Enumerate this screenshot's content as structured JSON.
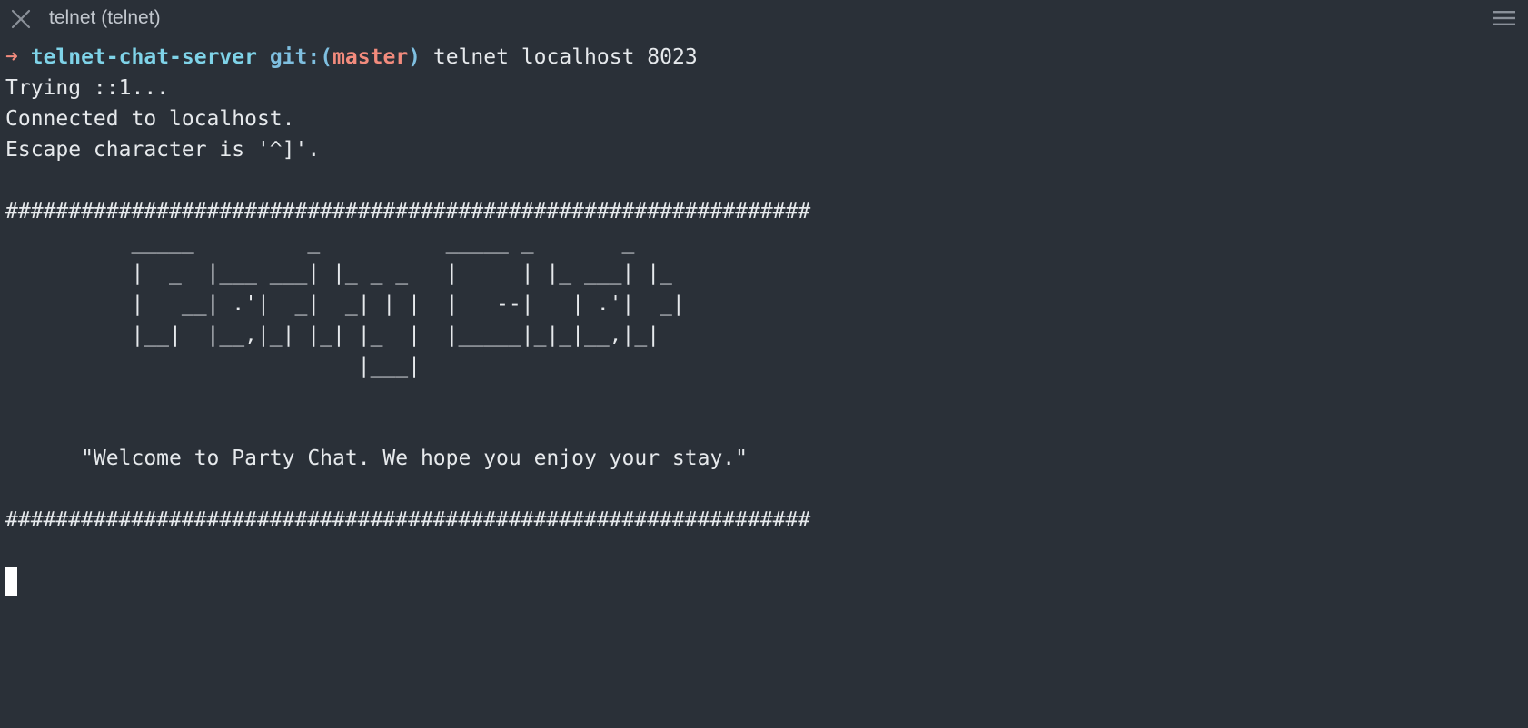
{
  "window": {
    "title": "telnet (telnet)",
    "close_icon": "close-icon",
    "menu_icon": "hamburger-menu-icon"
  },
  "colors": {
    "background": "#2a3038",
    "text": "#e6e9ec",
    "prompt_arrow": "#f28b7d",
    "directory": "#7fd3e8",
    "git_label": "#7fbfe0",
    "branch": "#f28b7d"
  },
  "prompt": {
    "arrow": "➜",
    "directory": "telnet-chat-server",
    "git_open": "git:(",
    "branch": "master",
    "git_close": ")",
    "command": "telnet localhost 8023"
  },
  "output_lines": [
    "Trying ::1...",
    "Connected to localhost.",
    "Escape character is '^]'.",
    "",
    "################################################################",
    "          _____         _          _____ _       _",
    "          |  _  |___ ___| |_ _ _   |     | |_ ___| |_",
    "          |   __| .'|  _|  _| | |  |   --|   | .'|  _|",
    "          |__|  |__,|_| |_| |_  |  |_____|_|_|__,|_|",
    "                            |___|",
    "",
    "",
    "      \"Welcome to Party Chat. We hope you enjoy your stay.\"",
    "",
    "################################################################",
    ""
  ]
}
